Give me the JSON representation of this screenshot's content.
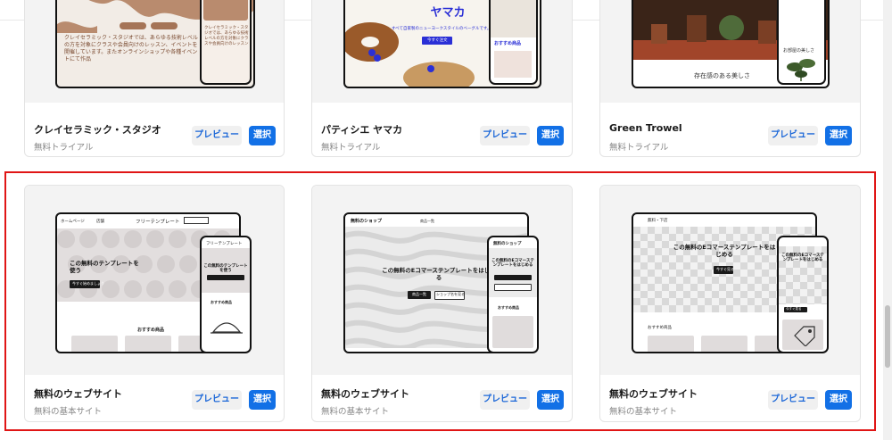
{
  "page": {
    "scrollbar_visible": true
  },
  "common": {
    "preview_label": "プレビュー",
    "select_label": "選択"
  },
  "top_row": [
    {
      "title": "クレイセラミック・スタジオ",
      "subtitle": "無料トライアル",
      "thumb_text": {
        "body": "クレイセラミック・スタジオでは、あらゆる技術レベルの方を対象にクラスや会員向けのレッスン、イベントを開催しています。またオンラインショップや各種イベントにて作品"
      }
    },
    {
      "title": "パティシエ ヤマカ",
      "subtitle": "無料トライアル",
      "thumb_text": {
        "heading": "ヤマカ",
        "sub": "すべて自家製のニューヨークスタイルのベーグルです。",
        "btn": "今すぐ注文",
        "phone_label": "おすすめ商品"
      }
    },
    {
      "title": "Green Trowel",
      "subtitle": "無料トライアル",
      "thumb_text": {
        "caption": "存在感のある美しさ",
        "phone_label": "お部屋の美しさ"
      }
    }
  ],
  "bottom_row": [
    {
      "title": "無料のウェブサイト",
      "subtitle": "無料の基本サイト",
      "thumb_text": {
        "nav_left": "ホームページ",
        "nav_right": "店舗",
        "brand": "フリーテンプレート",
        "hero": "この無料のテンプレートを使う",
        "cta": "今すぐ始めましょう",
        "section": "おすすめ商品",
        "phone_brand": "フリーテンプレート",
        "phone_hero": "この無料のテンプレートを使う"
      }
    },
    {
      "title": "無料のウェブサイト",
      "subtitle": "無料の基本サイト",
      "thumb_text": {
        "brand": "無料のショップ",
        "nav": "商品一覧",
        "hero": "この無料のEコマーステンプレートをはじめる",
        "btn1": "商品一覧",
        "btn2": "ショップ名を見る",
        "phone_brand": "無料のショップ",
        "phone_hero": "この無料のEコマーステンプレートをはじめる",
        "phone_section": "おすすめ商品"
      }
    },
    {
      "title": "無料のウェブサイト",
      "subtitle": "無料の基本サイト",
      "thumb_text": {
        "brand": "無料・下店",
        "hero": "この無料のEコマーステンプレートをはじめる",
        "btn": "今すぐ見る",
        "section": "おすすめ商品",
        "phone_hero": "この無料のEコマーステンプレートをはじめる",
        "phone_btn": "今すぐ見る"
      }
    }
  ],
  "colors": {
    "accent_blue": "#1270e6",
    "highlight_red": "#e01515",
    "clay": "#b98b6e",
    "bagel_blue": "#2a2fd6"
  }
}
